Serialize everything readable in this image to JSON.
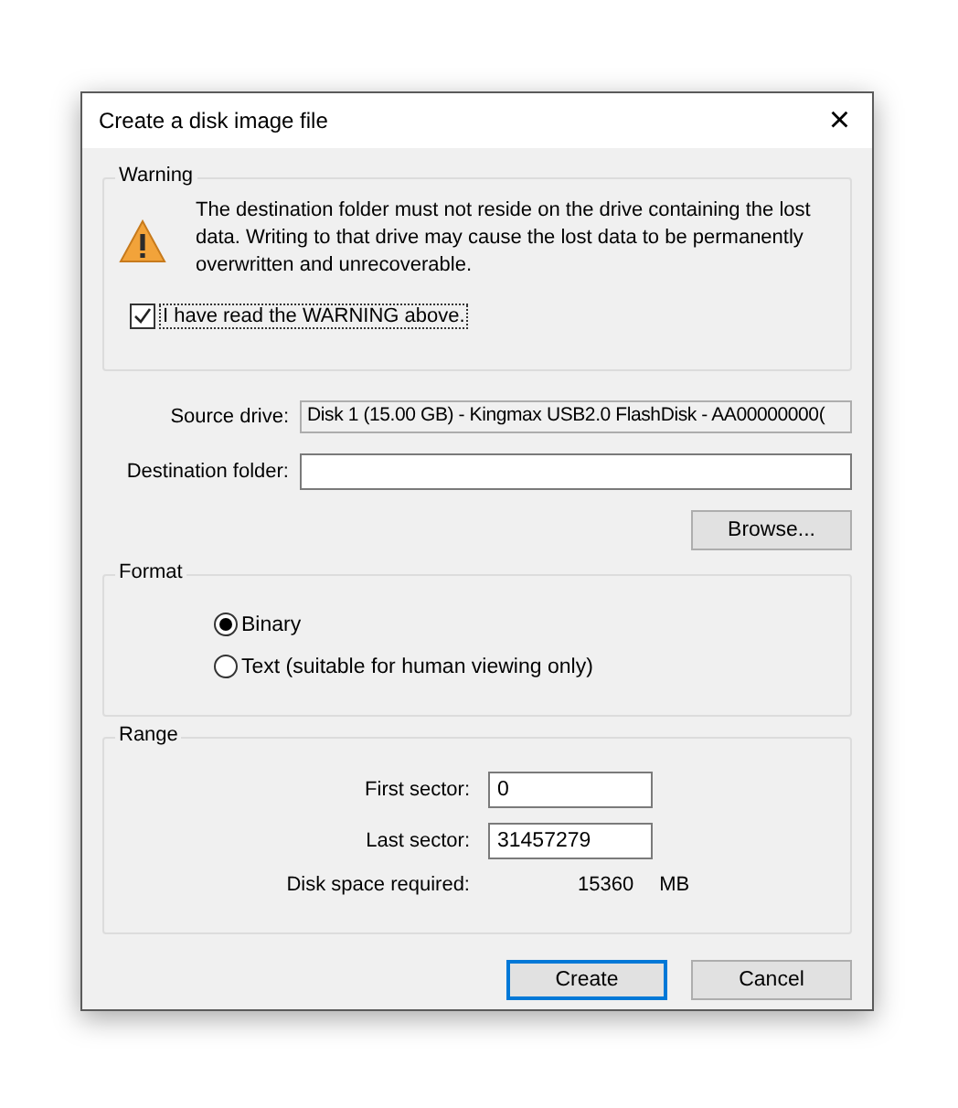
{
  "window": {
    "title": "Create a disk image file",
    "close": "×"
  },
  "warning": {
    "title": "Warning",
    "message": "The destination folder must not reside on the drive containing the lost data. Writing to that drive may cause the lost data to be permanently overwritten and unrecoverable.",
    "acknowledge": {
      "label": "I have read the WARNING above.",
      "checked": true
    }
  },
  "source_drive": {
    "label": "Source drive:",
    "value": "Disk 1 (15.00 GB) - Kingmax USB2.0 FlashDisk - AA00000000("
  },
  "destination_folder": {
    "label": "Destination folder:"
  },
  "browse_button": "Browse...",
  "format": {
    "title": "Format",
    "options": [
      {
        "label": "Binary",
        "selected": true
      },
      {
        "label": "Text (suitable for human viewing only)",
        "selected": false
      }
    ]
  },
  "range": {
    "title": "Range",
    "first_sector": {
      "label": "First sector:",
      "value": "0"
    },
    "last_sector": {
      "label": "Last sector:",
      "value": "31457279"
    },
    "disk_space": {
      "label": "Disk space required:",
      "value": "15360",
      "unit": "MB"
    }
  },
  "buttons": [
    {
      "label": "Create",
      "default": true
    },
    {
      "label": "Cancel",
      "default": false
    }
  ]
}
